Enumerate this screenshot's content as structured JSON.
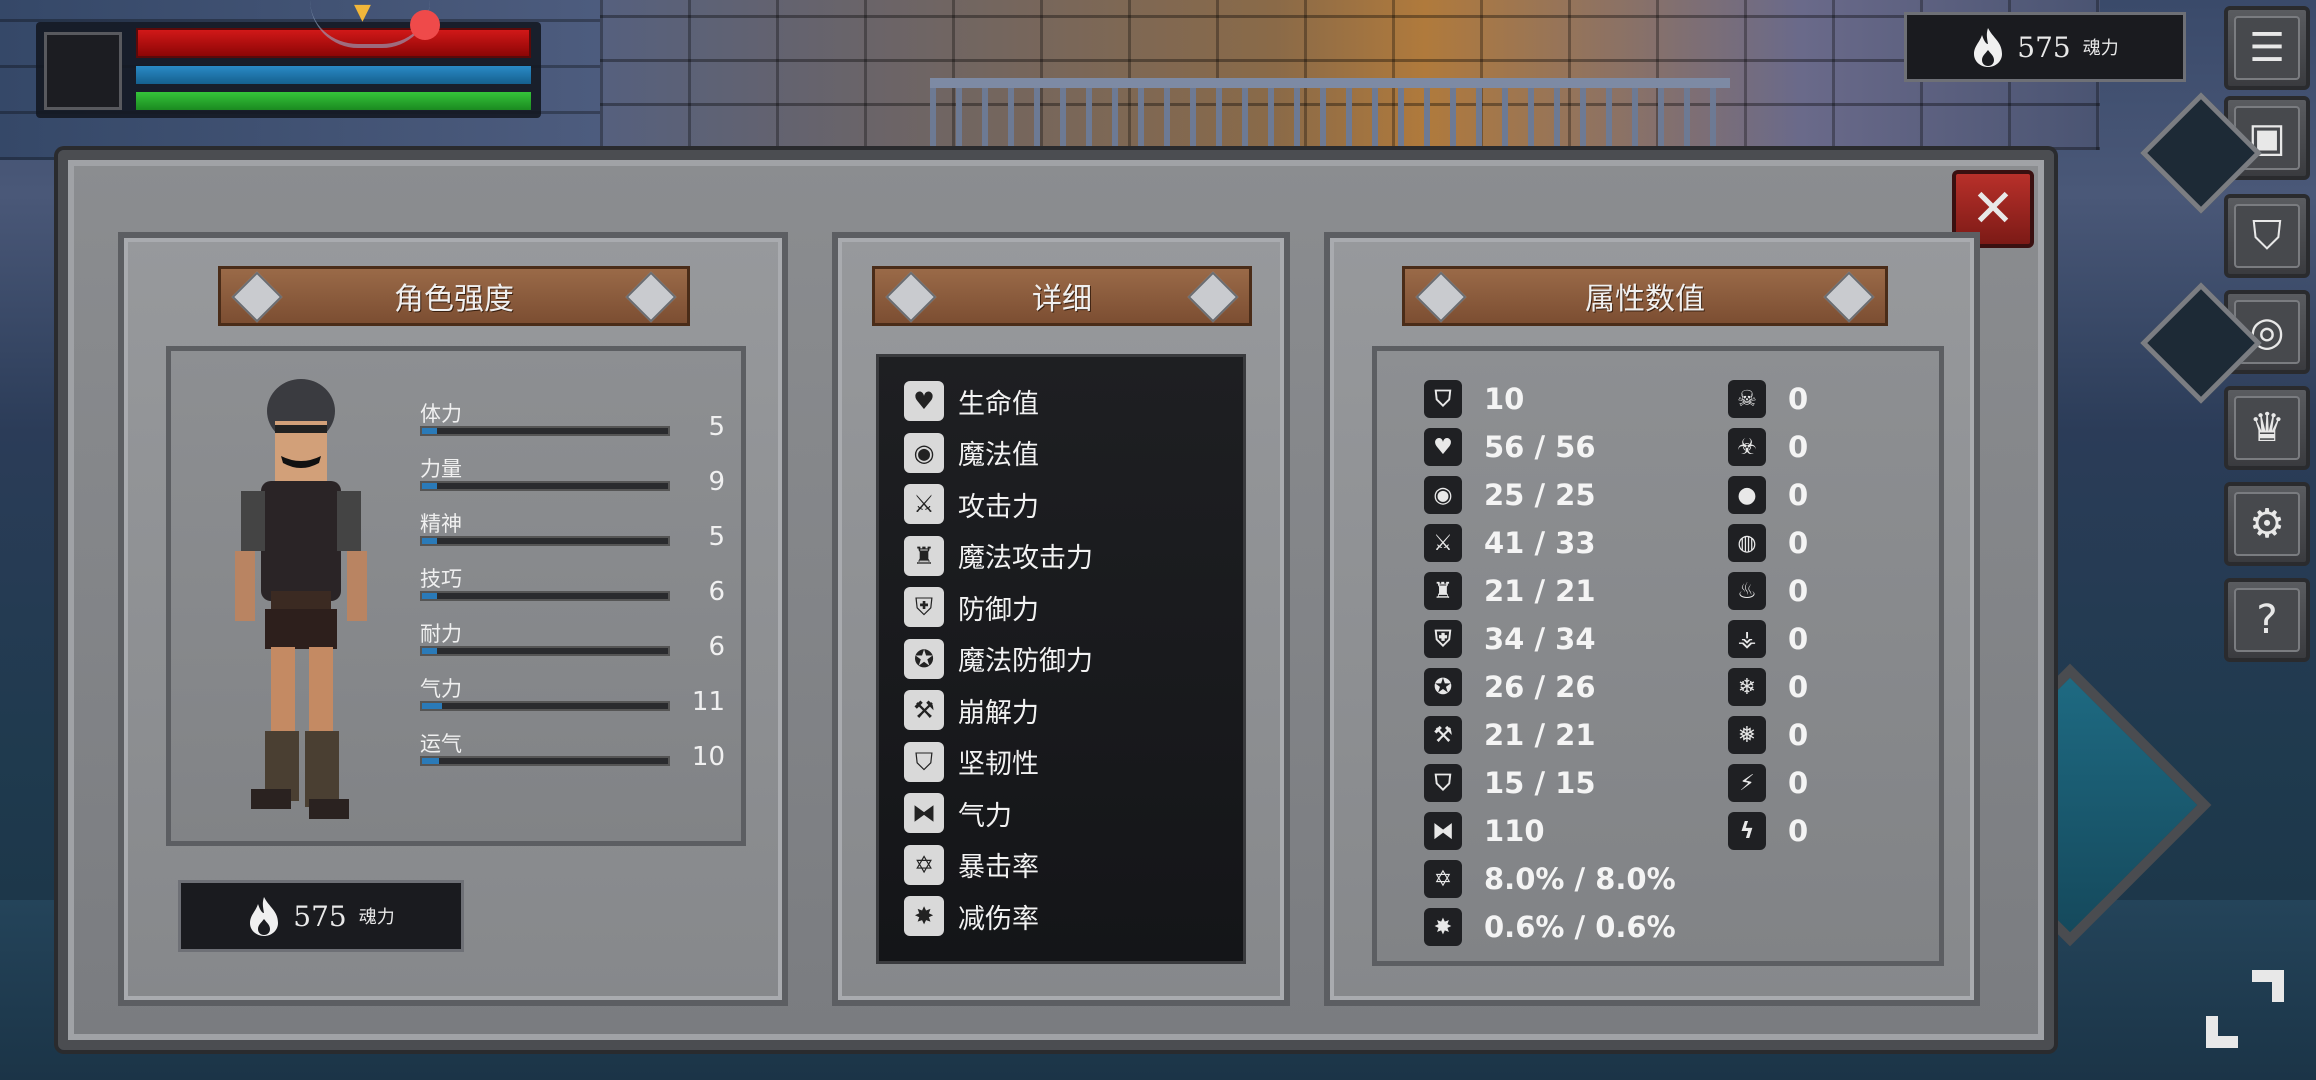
{
  "hud": {
    "soul_value": "575",
    "soul_unit": "魂力"
  },
  "sidebar": {
    "buttons": [
      {
        "icon": "menu-icon",
        "glyph": "☰"
      },
      {
        "icon": "inventory-icon",
        "glyph": "▣"
      },
      {
        "icon": "helmet-icon",
        "glyph": "⛉"
      },
      {
        "icon": "shield-emblem-icon",
        "glyph": "◎"
      },
      {
        "icon": "crown-icon",
        "glyph": "♛"
      },
      {
        "icon": "gear-icon",
        "glyph": "⚙"
      },
      {
        "icon": "help-icon",
        "glyph": "?"
      }
    ]
  },
  "panel": {
    "close_glyph": "✕",
    "character": {
      "title": "角色强度",
      "stats": [
        {
          "name": "体力",
          "value": "5",
          "fill": 0.03
        },
        {
          "name": "力量",
          "value": "9",
          "fill": 0.05
        },
        {
          "name": "精神",
          "value": "5",
          "fill": 0.03
        },
        {
          "name": "技巧",
          "value": "6",
          "fill": 0.04
        },
        {
          "name": "耐力",
          "value": "6",
          "fill": 0.04
        },
        {
          "name": "气力",
          "value": "11",
          "fill": 0.08
        },
        {
          "name": "运气",
          "value": "10",
          "fill": 0.07
        }
      ],
      "soul_value": "575",
      "soul_unit": "魂力"
    },
    "details": {
      "title": "详细",
      "items": [
        {
          "icon": "heart-icon",
          "glyph": "♥",
          "label": "生命值"
        },
        {
          "icon": "brain-icon",
          "glyph": "◉",
          "label": "魔法值"
        },
        {
          "icon": "sword-icon",
          "glyph": "⚔",
          "label": "攻击力"
        },
        {
          "icon": "magic-attack-icon",
          "glyph": "♜",
          "label": "魔法攻击力"
        },
        {
          "icon": "shield-icon",
          "glyph": "⛨",
          "label": "防御力"
        },
        {
          "icon": "magic-shield-icon",
          "glyph": "✪",
          "label": "魔法防御力"
        },
        {
          "icon": "hammer-icon",
          "glyph": "⚒",
          "label": "崩解力"
        },
        {
          "icon": "helmet-icon",
          "glyph": "⛉",
          "label": "坚韧性"
        },
        {
          "icon": "lungs-icon",
          "glyph": "⧓",
          "label": "气力"
        },
        {
          "icon": "star-burst-icon",
          "glyph": "✡",
          "label": "暴击率"
        },
        {
          "icon": "badge-icon",
          "glyph": "✸",
          "label": "减伤率"
        }
      ]
    },
    "attributes": {
      "title": "属性数值",
      "left": [
        {
          "icon": "helmet-icon",
          "glyph": "⛉",
          "value": "10"
        },
        {
          "icon": "heart-icon",
          "glyph": "♥",
          "value": "56 / 56"
        },
        {
          "icon": "brain-icon",
          "glyph": "◉",
          "value": "25 / 25"
        },
        {
          "icon": "sword-icon",
          "glyph": "⚔",
          "value": "41 / 33"
        },
        {
          "icon": "magic-attack-icon",
          "glyph": "♜",
          "value": "21 / 21"
        },
        {
          "icon": "shield-icon",
          "glyph": "⛨",
          "value": "34 / 34"
        },
        {
          "icon": "magic-shield-icon",
          "glyph": "✪",
          "value": "26 / 26"
        },
        {
          "icon": "hammer-icon",
          "glyph": "⚒",
          "value": "21 / 21"
        },
        {
          "icon": "helmet-icon",
          "glyph": "⛉",
          "value": "15 / 15"
        },
        {
          "icon": "lungs-icon",
          "glyph": "⧓",
          "value": "110"
        },
        {
          "icon": "star-burst-icon",
          "glyph": "✡",
          "value": "8.0% / 8.0%"
        },
        {
          "icon": "badge-icon",
          "glyph": "✸",
          "value": "0.6% / 0.6%"
        }
      ],
      "right": [
        {
          "icon": "poison-skull-icon",
          "glyph": "☠",
          "value": "0"
        },
        {
          "icon": "poison-resist-icon",
          "glyph": "☣",
          "value": "0"
        },
        {
          "icon": "water-drop-icon",
          "glyph": "●",
          "value": "0"
        },
        {
          "icon": "water-resist-icon",
          "glyph": "◍",
          "value": "0"
        },
        {
          "icon": "fire-icon",
          "glyph": "♨",
          "value": "0"
        },
        {
          "icon": "fire-resist-icon",
          "glyph": "⚶",
          "value": "0"
        },
        {
          "icon": "snowflake-icon",
          "glyph": "❄",
          "value": "0"
        },
        {
          "icon": "frost-resist-icon",
          "glyph": "❅",
          "value": "0"
        },
        {
          "icon": "lightning-icon",
          "glyph": "⚡",
          "value": "0"
        },
        {
          "icon": "lightning-resist-icon",
          "glyph": "ϟ",
          "value": "0"
        }
      ]
    }
  }
}
